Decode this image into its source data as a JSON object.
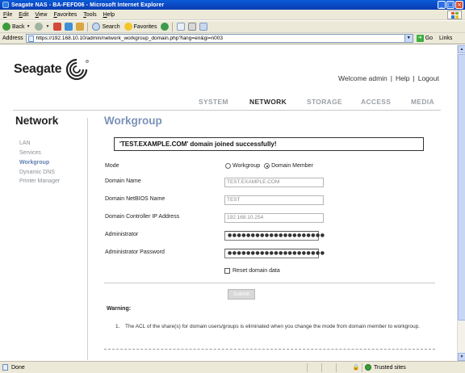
{
  "window": {
    "title": "Seagate NAS - BA-FEFD06 - Microsoft Internet Explorer",
    "buttons": [
      "_",
      "□",
      "×"
    ]
  },
  "menu": [
    "File",
    "Edit",
    "View",
    "Favorites",
    "Tools",
    "Help"
  ],
  "toolbar": {
    "back_label": "Back",
    "search_label": "Search",
    "favorites_label": "Favorites"
  },
  "address": {
    "label": "Address",
    "url": "https://192.168.10.10/admin/network_workgroup_domain.php?lang=en&gi=n003",
    "go_label": "Go",
    "links_label": "Links"
  },
  "page": {
    "logo_text": "Seagate",
    "user": {
      "welcome": "Welcome admin",
      "help": "Help",
      "logout": "Logout",
      "separator": "|"
    },
    "main_nav": {
      "system": "SYSTEM",
      "network": "NETWORK",
      "storage": "STORAGE",
      "access": "ACCESS",
      "media": "MEDIA"
    },
    "section_title": "Network",
    "sub_nav": [
      "LAN",
      "Services",
      "Workgroup",
      "Dynamic DNS",
      "Printer Manager"
    ],
    "page_title": "Workgroup",
    "message": "'TEST.EXAMPLE.COM' domain joined successfully!",
    "form": {
      "mode_label": "Mode",
      "mode_options": [
        "Workgroup",
        "Domain Member"
      ],
      "mode_selected": "Domain Member",
      "domain_name_label": "Domain Name",
      "domain_name_value": "TEST.EXAMPLE.COM",
      "netbios_label": "Domain NetBIOS Name",
      "netbios_value": "TEST",
      "dc_ip_label": "Domain Controller IP Address",
      "dc_ip_value": "192.168.10.254",
      "admin_label": "Administrator",
      "admin_value": "●●●●●●●●●●●●●●●●●●●●●",
      "admin_password_label": "Administrator Password",
      "admin_password_value": "●●●●●●●●●●●●●●●●●●●●●",
      "reset_label": "Reset domain data",
      "reset_checked": false,
      "submit_label": "Submit"
    },
    "warning": {
      "title": "Warning:",
      "items": [
        {
          "number": "1.",
          "text": "The ACL of the share(s) for domain users/groups is eliminated when you change the mode from domain member to workgroup."
        }
      ]
    }
  },
  "status": {
    "left": "Done",
    "zone": "Trusted sites"
  },
  "colors": {
    "title_bar": "#0b46c1",
    "chrome": "#ece9d8",
    "accent_title": "#7a92b8",
    "active_subnav": "#5e7fb1"
  }
}
